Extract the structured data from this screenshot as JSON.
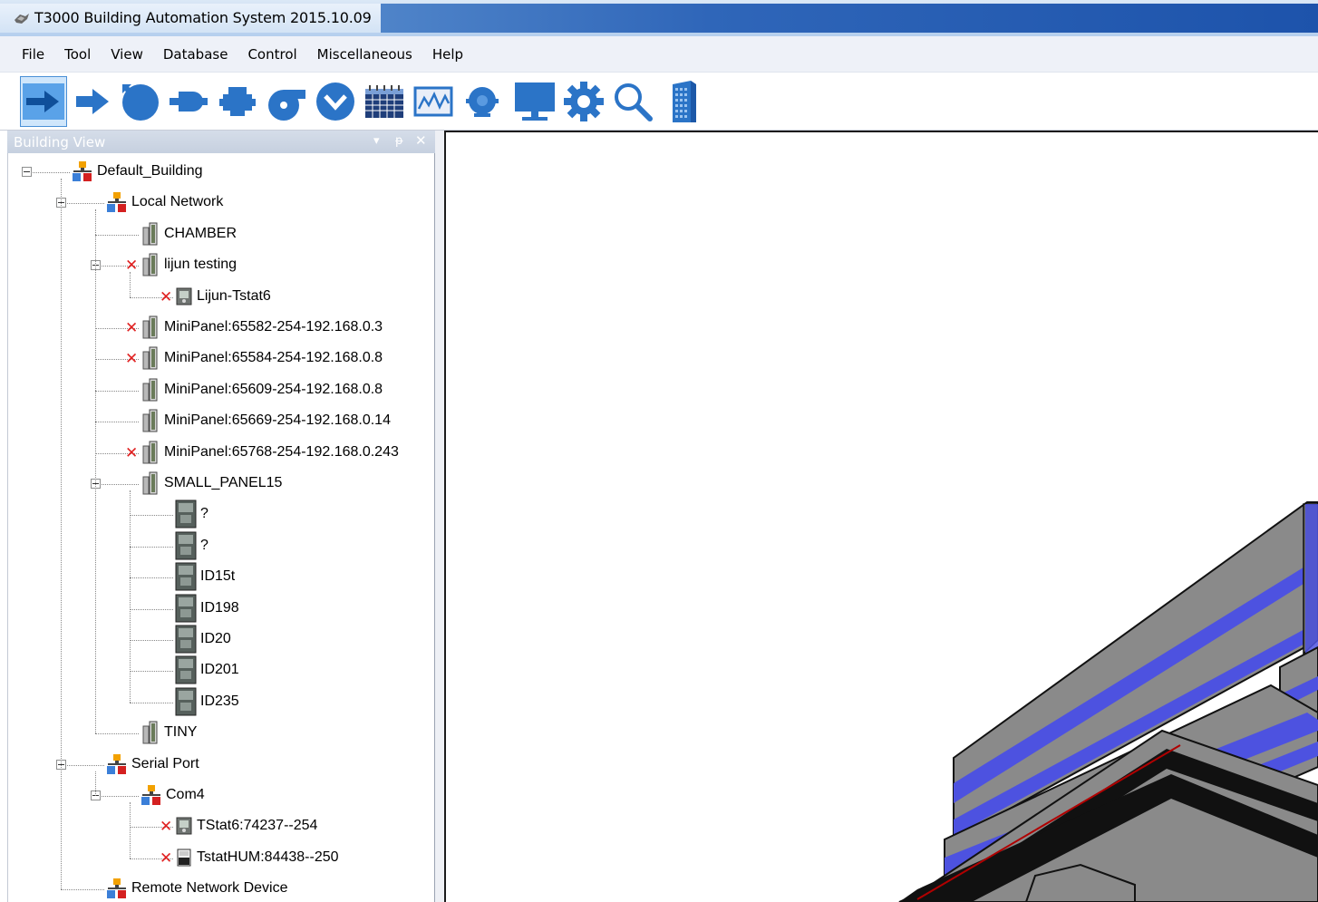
{
  "window": {
    "title": "T3000 Building Automation System    2015.10.09"
  },
  "menu": [
    "File",
    "Tool",
    "View",
    "Database",
    "Control",
    "Miscellaneous",
    "Help"
  ],
  "toolbar": {
    "buttons": [
      {
        "name": "connect-arrow-icon",
        "selected": true
      },
      {
        "name": "input-arrow-icon"
      },
      {
        "name": "gauge-icon"
      },
      {
        "name": "plug-icon"
      },
      {
        "name": "output-icon"
      },
      {
        "name": "fan-icon"
      },
      {
        "name": "dropdown-circle-icon"
      },
      {
        "name": "schedule-calendar-icon"
      },
      {
        "name": "trend-chart-icon"
      },
      {
        "name": "alarm-bell-icon"
      },
      {
        "name": "monitor-icon"
      },
      {
        "name": "settings-gear-icon"
      },
      {
        "name": "search-icon"
      },
      {
        "name": "building-icon"
      }
    ]
  },
  "building_view": {
    "title": "Building View",
    "controls": [
      "▾",
      "ᵽ",
      "✕"
    ],
    "tree": [
      {
        "label": "Default_Building",
        "icon": "network",
        "level": 0,
        "expand": true
      },
      {
        "label": "Local Network",
        "icon": "network",
        "level": 1,
        "expand": true
      },
      {
        "label": "CHAMBER",
        "icon": "panel",
        "level": 2
      },
      {
        "label": "lijun testing",
        "icon": "panel",
        "level": 2,
        "expand": true,
        "offline": true
      },
      {
        "label": "Lijun-Tstat6",
        "icon": "tstat",
        "level": 3,
        "offline": true
      },
      {
        "label": "MiniPanel:65582-254-192.168.0.3",
        "icon": "panel",
        "level": 2,
        "offline": true
      },
      {
        "label": "MiniPanel:65584-254-192.168.0.8",
        "icon": "panel",
        "level": 2,
        "offline": true
      },
      {
        "label": "MiniPanel:65609-254-192.168.0.8",
        "icon": "panel",
        "level": 2
      },
      {
        "label": "MiniPanel:65669-254-192.168.0.14",
        "icon": "panel",
        "level": 2
      },
      {
        "label": "MiniPanel:65768-254-192.168.0.243",
        "icon": "panel",
        "level": 2,
        "offline": true
      },
      {
        "label": "SMALL_PANEL15",
        "icon": "panel",
        "level": 2,
        "expand": true
      },
      {
        "label": "?",
        "icon": "tstat-big",
        "level": 3
      },
      {
        "label": "?",
        "icon": "tstat-big",
        "level": 3
      },
      {
        "label": "ID15t",
        "icon": "tstat-big",
        "level": 3
      },
      {
        "label": "ID198",
        "icon": "tstat-big",
        "level": 3
      },
      {
        "label": "ID20",
        "icon": "tstat-big",
        "level": 3
      },
      {
        "label": "ID201",
        "icon": "tstat-big",
        "level": 3
      },
      {
        "label": "ID235",
        "icon": "tstat-big",
        "level": 3
      },
      {
        "label": "TINY",
        "icon": "panel",
        "level": 2
      },
      {
        "label": "Serial Port",
        "icon": "network",
        "level": 1,
        "expand": true
      },
      {
        "label": "Com4",
        "icon": "network",
        "level": 2,
        "expand": true
      },
      {
        "label": "TStat6:74237--254",
        "icon": "tstat",
        "level": 3,
        "offline": true
      },
      {
        "label": "TstatHUM:84438--250",
        "icon": "hum",
        "level": 3,
        "offline": true
      },
      {
        "label": "Remote Network Device",
        "icon": "network",
        "level": 1
      }
    ]
  },
  "colors": {
    "accent_blue": "#2b74c7",
    "offline_red": "#e02020",
    "building_blue": "#4d52e0",
    "building_gray": "#8a8a8a"
  }
}
